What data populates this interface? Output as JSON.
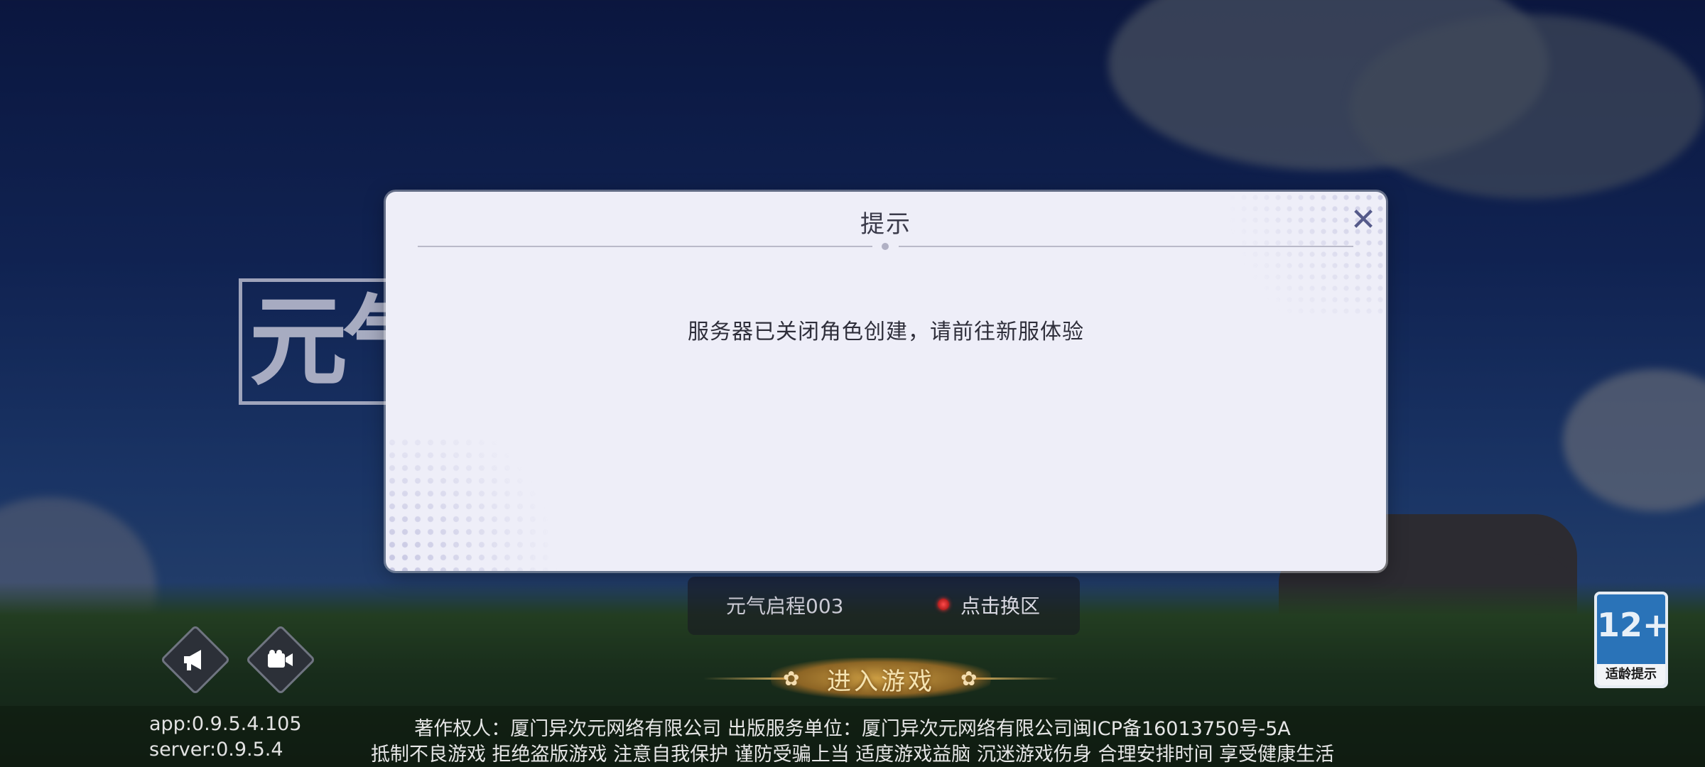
{
  "dialog": {
    "title": "提示",
    "message": "服务器已关闭角色创建，请前往新服体验",
    "close_icon": "close-icon"
  },
  "logo": {
    "text": "元气"
  },
  "server": {
    "name": "元气启程003",
    "switch_label": "点击换区",
    "status_color": "#ff3b3b"
  },
  "enter_button": {
    "label": "进入游戏"
  },
  "toolbar": {
    "announce_icon": "megaphone-icon",
    "video_icon": "video-camera-icon"
  },
  "age_rating": {
    "number": "12+",
    "label": "适龄提示"
  },
  "footer": {
    "app_version": "app:0.9.5.4.105",
    "server_version": "server:0.9.5.4",
    "copyright_line": "著作权人：厦门异次元网络有限公司  出版服务单位：厦门异次元网络有限公司闽ICP备16013750号-5A",
    "health_line": "抵制不良游戏  拒绝盗版游戏  注意自我保护  谨防受骗上当  适度游戏益脑  沉迷游戏伤身  合理安排时间  享受健康生活"
  }
}
